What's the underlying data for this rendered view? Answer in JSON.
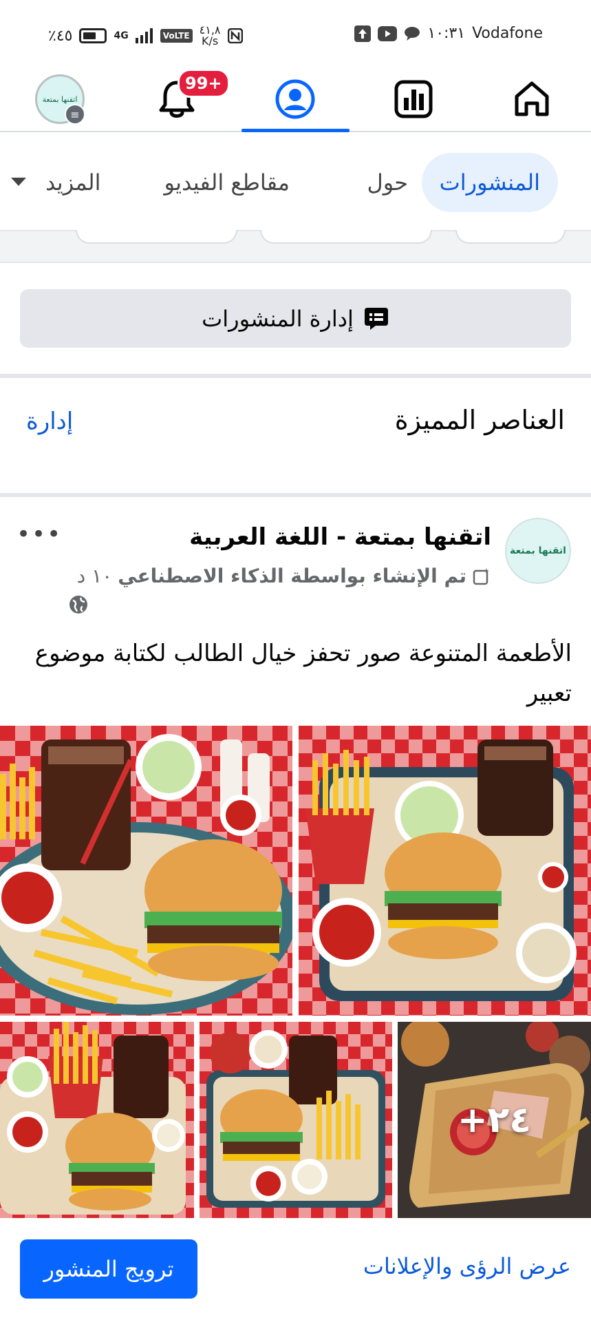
{
  "status_bar": {
    "carrier": "Vodafone",
    "time": "١٠:٣١",
    "battery": "٪٤٥",
    "speed_value": "٤١,٨",
    "speed_unit": "K/s",
    "network": "4G",
    "volte": "VoLTE"
  },
  "nav": {
    "notification_badge": "99+",
    "avatar_text": "اتقنها بمتعة"
  },
  "tabs": [
    {
      "label": "المنشورات",
      "active": true
    },
    {
      "label": "حول",
      "active": false
    },
    {
      "label": "مقاطع الفيديو",
      "active": false
    },
    {
      "label": "المزيد",
      "active": false
    }
  ],
  "manage_posts": {
    "label": "إدارة المنشورات"
  },
  "featured": {
    "title": "العناصر المميزة",
    "manage_label": "إدارة"
  },
  "post": {
    "author": "اتقنها بمتعة - اللغة العربية",
    "avatar_text": "اتقنها بمتعة",
    "ai_label": "تم الإنشاء بواسطة الذكاء الاصطناعي",
    "time": "١٠ د",
    "more": "•••",
    "text": "الأطعمة المتنوعة صور تحفز خيال الطالب لكتابة موضوع تعبير",
    "more_photos": "+٢٤"
  },
  "bottom": {
    "promote_label": "ترويج المنشور",
    "insights_label": "عرض الرؤى والإعلانات"
  },
  "colors": {
    "accent": "#0866ff",
    "link": "#0b5ad9",
    "badge": "#e41e3f",
    "active_tab_bg": "#e7f0fd"
  }
}
